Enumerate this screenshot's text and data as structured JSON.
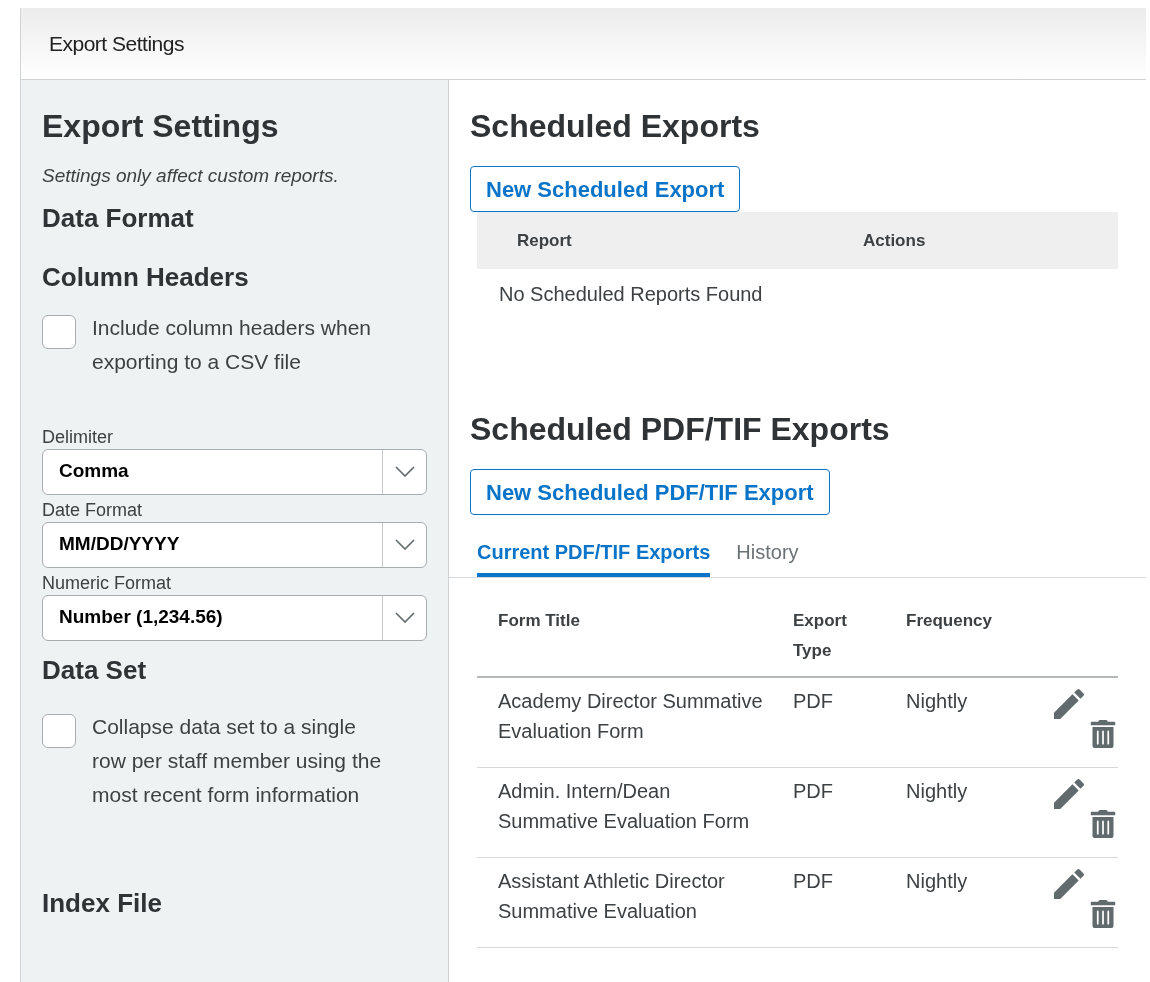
{
  "header": {
    "title": "Export Settings"
  },
  "settings": {
    "title": "Export Settings",
    "note": "Settings only affect custom reports.",
    "data_format_heading": "Data Format",
    "column_headers_heading": "Column Headers",
    "column_headers_option": {
      "label": "Include column headers when exporting to a CSV file",
      "checked": false
    },
    "selects": [
      {
        "label": "Delimiter",
        "value": "Comma"
      },
      {
        "label": "Date Format",
        "value": "MM/DD/YYYY"
      },
      {
        "label": "Numeric Format",
        "value": "Number (1,234.56)"
      }
    ],
    "data_set_heading": "Data Set",
    "data_set_option": {
      "label": "Collapse data set to a single row per staff member using the most recent form information",
      "checked": false
    },
    "index_file_heading": "Index File"
  },
  "scheduled_exports": {
    "title": "Scheduled Exports",
    "button": "New Scheduled Export",
    "columns": [
      "Report",
      "Actions"
    ],
    "empty_message": "No Scheduled Reports Found"
  },
  "pdf_exports": {
    "title": "Scheduled PDF/TIF Exports",
    "button": "New Scheduled PDF/TIF Export",
    "tabs": [
      {
        "label": "Current PDF/TIF Exports",
        "selected": true
      },
      {
        "label": "History",
        "selected": false
      }
    ],
    "columns": [
      "Form Title",
      "Export Type",
      "Frequency"
    ],
    "rows": [
      {
        "form_title": "Academy Director Summative Evaluation Form",
        "export_type": "PDF",
        "frequency": "Nightly"
      },
      {
        "form_title": "Admin. Intern/Dean Summative Evaluation Form",
        "export_type": "PDF",
        "frequency": "Nightly"
      },
      {
        "form_title": "Assistant Athletic Director Summative Evaluation",
        "export_type": "PDF",
        "frequency": "Nightly"
      }
    ]
  }
}
